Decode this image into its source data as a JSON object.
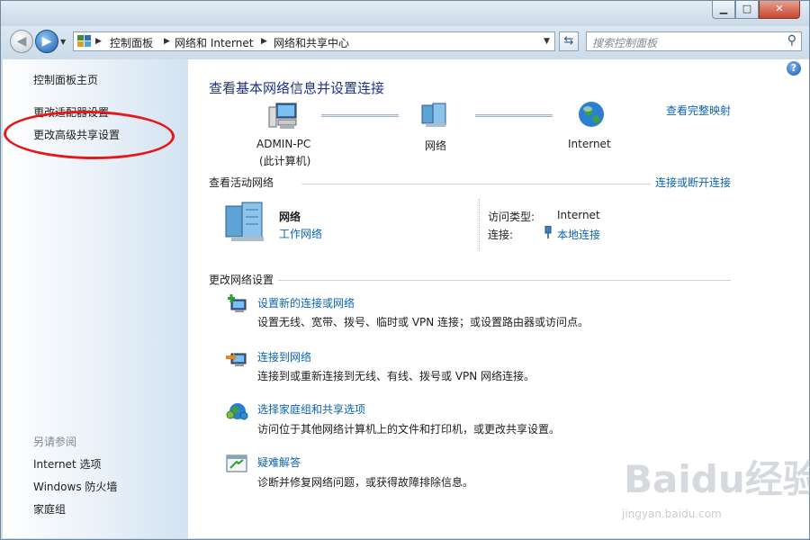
{
  "window": {
    "controls": {
      "minimize": "▁",
      "maximize": "□",
      "close": "✕"
    }
  },
  "navbar": {
    "back": "◀",
    "forward": "▶",
    "breadcrumb": [
      "控制面板",
      "网络和 Internet",
      "网络和共享中心"
    ],
    "search_placeholder": "搜索控制面板",
    "search_icon": "search-icon",
    "refresh_icon": "refresh-icon"
  },
  "sidebar": {
    "items": [
      {
        "label": "控制面板主页"
      },
      {
        "label": "更改适配器设置"
      },
      {
        "label": "更改高级共享设置"
      }
    ],
    "see_also_title": "另请参阅",
    "see_also": [
      {
        "label": "Internet 选项"
      },
      {
        "label": "Windows 防火墙"
      },
      {
        "label": "家庭组"
      }
    ],
    "highlight_color": "#e11a1a"
  },
  "main": {
    "title": "查看基本网络信息并设置连接",
    "view_full_map": "查看完整映射",
    "map": {
      "computer_name": "ADMIN-PC",
      "computer_sub": "(此计算机)",
      "network": "网络",
      "internet": "Internet"
    },
    "active_networks": {
      "header": "查看活动网络",
      "connect_disconnect": "连接或断开连接",
      "network_name": "网络",
      "network_type": "工作网络",
      "access_type_label": "访问类型:",
      "access_type_value": "Internet",
      "connections_label": "连接:",
      "connections_value": "本地连接"
    },
    "change_settings": {
      "header": "更改网络设置",
      "tasks": [
        {
          "title": "设置新的连接或网络",
          "desc": "设置无线、宽带、拨号、临时或 VPN 连接；或设置路由器或访问点。"
        },
        {
          "title": "连接到网络",
          "desc": "连接到或重新连接到无线、有线、拨号或 VPN 网络连接。"
        },
        {
          "title": "选择家庭组和共享选项",
          "desc": "访问位于其他网络计算机上的文件和打印机，或更改共享设置。"
        },
        {
          "title": "疑难解答",
          "desc": "诊断并修复网络问题，或获得故障排除信息。"
        }
      ]
    },
    "help": "?"
  },
  "watermark": {
    "main": "Baidu经验",
    "sub": "jingyan.baidu.com"
  },
  "colors": {
    "link": "#0c63b6",
    "title": "#1e3287",
    "sidebar_bg": "#d3e2f1"
  }
}
